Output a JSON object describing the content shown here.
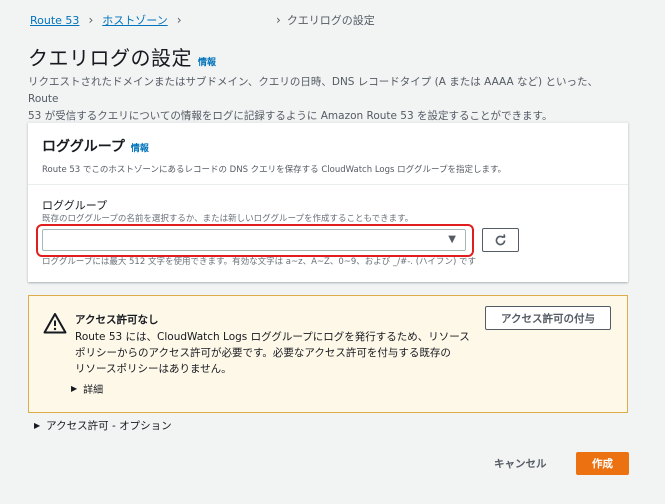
{
  "breadcrumb": {
    "items": [
      "Route 53",
      "ホストゾーン"
    ],
    "current": "クエリログの設定"
  },
  "page": {
    "title": "クエリログの設定",
    "info": "情報",
    "description_line1": "リクエストされたドメインまたはサブドメイン、クエリの日時、DNS レコードタイプ (A または AAAA など) といった、Route",
    "description_line2": "53 が受信するクエリについての情報をログに記録するように Amazon Route 53 を設定することができます。"
  },
  "log_group_panel": {
    "title": "ロググループ",
    "info": "情報",
    "description": "Route 53 でこのホストゾーンにあるレコードの DNS クエリを保存する CloudWatch Logs ロググループを指定します。",
    "field_label": "ロググループ",
    "field_hint": "既存のロググループの名前を選択するか、または新しいロググループを作成することもできます。",
    "selected_value": "",
    "constraint": "ロググループには最大 512 文字を使用できます。有効な文字は a~z、A~Z、0~9、および _/#-. (ハイフン) です"
  },
  "alert": {
    "title": "アクセス許可なし",
    "body_line1": "Route 53 には、CloudWatch Logs ロググループにログを発行するため、リソース",
    "body_line2": "ポリシーからのアクセス許可が必要です。必要なアクセス許可を付与する既存の",
    "body_line3": "リソースポリシーはありません。",
    "details": "詳細",
    "grant_button": "アクセス許可の付与"
  },
  "optional_section": "アクセス許可 - オプション",
  "footer": {
    "cancel": "キャンセル",
    "create": "作成"
  },
  "colors": {
    "link": "#0073bb",
    "primary_button": "#ec7211",
    "warning_border": "#ddad4c",
    "warning_bg": "#fef8e9",
    "highlight": "#e21d1d"
  }
}
